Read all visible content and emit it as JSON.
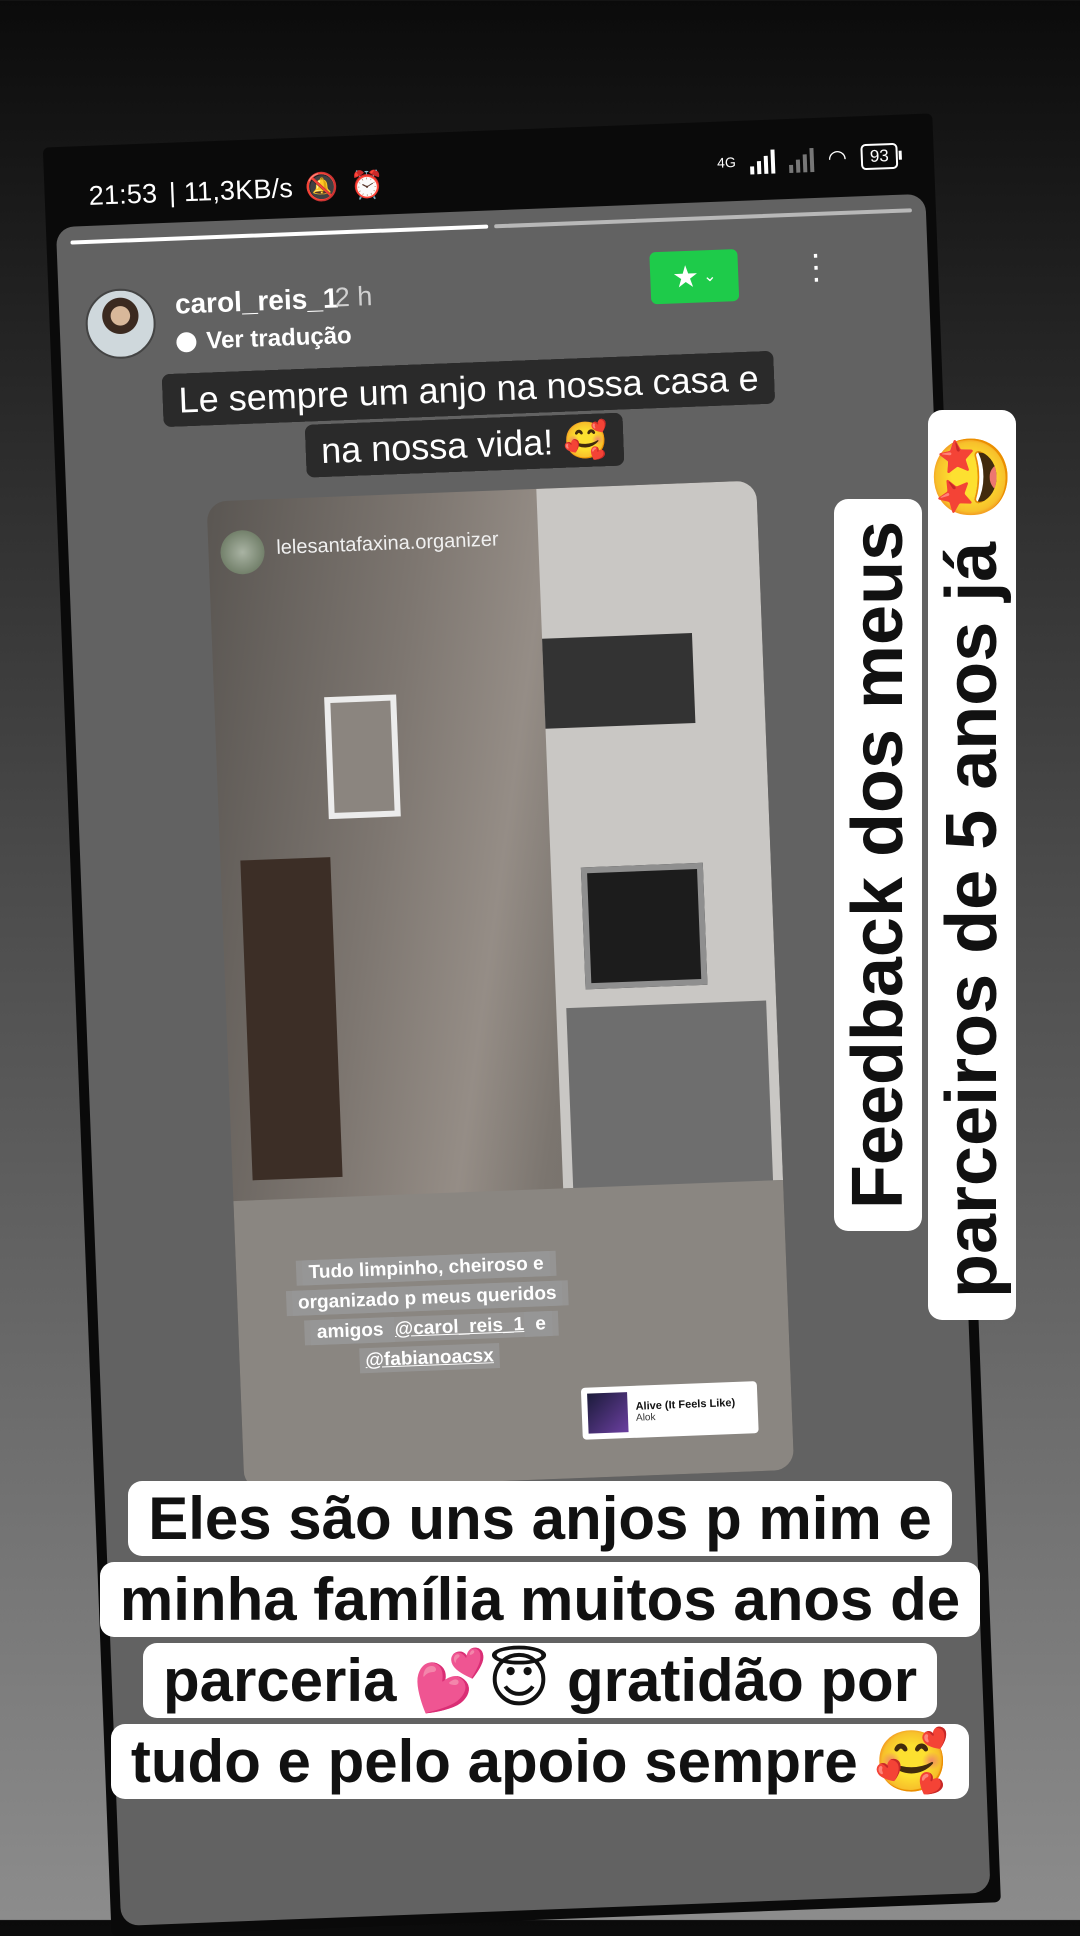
{
  "status_bar": {
    "time": "21:53",
    "speed": "| 11,3KB/s",
    "mute_icon": "bell-off-icon",
    "alarm_icon": "alarm-icon",
    "network": "4G",
    "wifi_icon": "wifi-icon",
    "battery": "93"
  },
  "story": {
    "username": "carol_reis_1",
    "time_ago": "2 h",
    "translate_label": "Ver tradução",
    "favorite_icon": "star-icon",
    "more_icon": "more-vertical-icon",
    "caption": "Le sempre um anjo na nossa casa e na nossa vida! 🥰",
    "repost": {
      "username": "lelesantafaxina.organizer",
      "caption_text": "Tudo limpinho, cheiroso e organizado p meus queridos amigos ",
      "mention_1": "@carol_reis_1",
      "connector": " e ",
      "mention_2": "@fabianoacsx",
      "music_title": "Alive (It Feels Like)",
      "music_artist": "Alok"
    }
  },
  "overlay": {
    "side_text": "Feedback dos meus parceiros de 5 anos já 🤩",
    "bottom_text": "Eles são uns anjos p mim e minha família muitos anos de parceria 💕😇 gratidão por tudo e pelo apoio sempre 🥰"
  },
  "colors": {
    "favorite_green": "#1ecb4a",
    "story_background": "#626262",
    "overlay_white": "#ffffff"
  }
}
